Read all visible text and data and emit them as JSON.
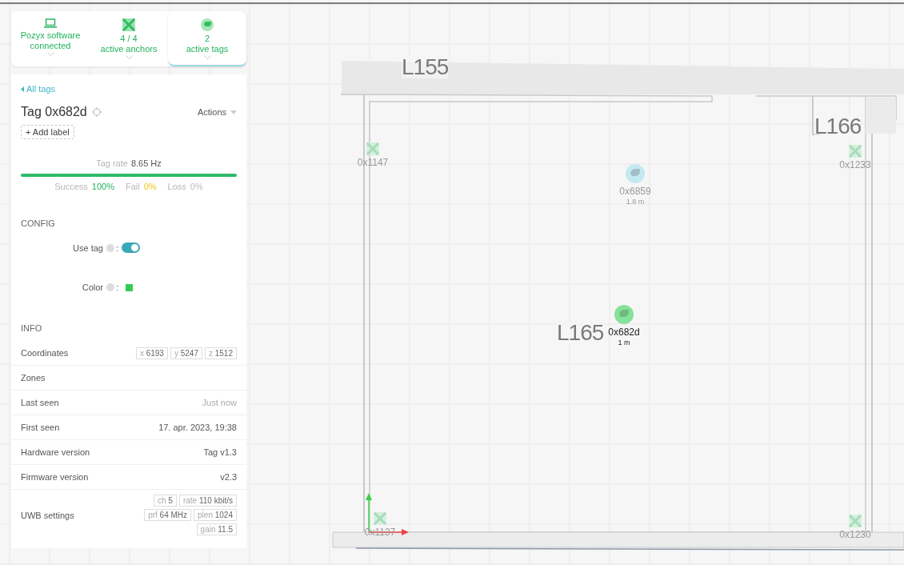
{
  "status_cards": [
    {
      "kind": "laptop",
      "line1": "Pozyx software",
      "line2": "connected",
      "selected": false
    },
    {
      "kind": "anchor",
      "line1": "4 / 4",
      "line2": "active anchors",
      "selected": false
    },
    {
      "kind": "tag",
      "line1": "2",
      "line2": "active tags",
      "selected": true
    }
  ],
  "tag_panel": {
    "back": "All tags",
    "title": "Tag 0x682d",
    "actions": "Actions",
    "add_label": "+ Add label",
    "rate": {
      "label": "Tag rate",
      "value": "8.65 Hz",
      "level": 1
    },
    "stats": [
      {
        "label": "Success",
        "value": "100%",
        "kind": "success"
      },
      {
        "label": "Fail",
        "value": "0%",
        "kind": "fail"
      },
      {
        "label": "Loss",
        "value": "0%",
        "kind": "loss"
      }
    ],
    "config": {
      "heading": "CONFIG",
      "use_tag": {
        "label": "Use tag",
        "colon": ":",
        "on": true
      },
      "color": {
        "label": "Color",
        "colon": ":",
        "color": "#33cc55"
      }
    },
    "info": {
      "heading": "INFO",
      "rows": [
        {
          "label": "Coordinates",
          "chips": [
            {
              "key": "x",
              "value": "6193"
            },
            {
              "key": "y",
              "value": "5247"
            },
            {
              "key": "z",
              "value": "1512"
            }
          ]
        },
        {
          "label": "Zones"
        },
        {
          "label": "Last seen",
          "value": "Just now",
          "muted": true
        },
        {
          "label": "First seen",
          "value": "17. apr. 2023, 19:38",
          "muted": false
        },
        {
          "label": "Hardware version",
          "value": "Tag v1.3",
          "muted": false
        },
        {
          "label": "Firmware version",
          "value": "v2.3",
          "muted": false
        },
        {
          "label": "UWB settings",
          "chips": [
            {
              "key": "ch",
              "value": "5"
            },
            {
              "key": "rate",
              "value": "110 kbit/s"
            },
            {
              "key": "prf",
              "value": "64 MHz"
            },
            {
              "key": "plen",
              "value": "1024"
            },
            {
              "key": "gain",
              "value": "11.5"
            }
          ]
        }
      ]
    }
  },
  "map": {
    "rooms": [
      "L155",
      "L166",
      "L165"
    ],
    "anchors": [
      {
        "id": "0x1147"
      },
      {
        "id": "0x1233"
      },
      {
        "id": "0x1137"
      },
      {
        "id": "0x1230"
      }
    ],
    "tags": [
      {
        "id": "0x6859",
        "distance": "1.8 m",
        "color": "#c4e9f0",
        "selected": false
      },
      {
        "id": "0x682d",
        "distance": "1 m",
        "color": "#86e29a",
        "selected": true
      }
    ]
  }
}
